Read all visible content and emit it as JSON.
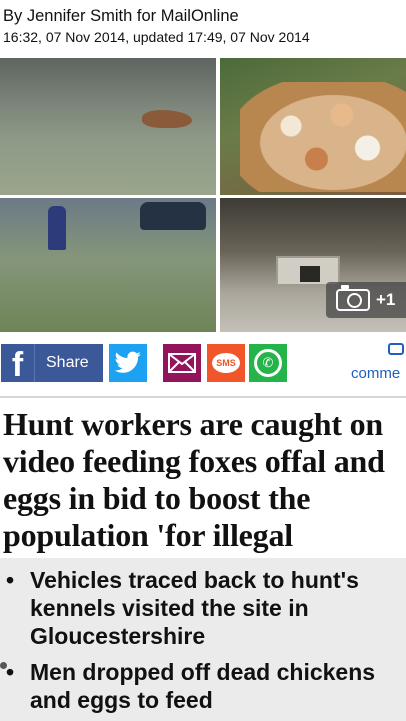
{
  "byline": {
    "author": "By Jennifer Smith for MailOnline",
    "dates": "16:32, 07 Nov 2014, updated 17:49, 07 Nov 2014"
  },
  "gallery": {
    "photo_count": "+1",
    "icons": [
      "camera-icon"
    ]
  },
  "share": {
    "facebook_label": "Share",
    "comments_label": "comme",
    "icons": [
      "facebook-icon",
      "twitter-icon",
      "email-icon",
      "sms-icon",
      "whatsapp-icon",
      "comment-icon"
    ],
    "sms_text": "SMS",
    "colors": {
      "facebook": "#3b5998",
      "twitter": "#1da1f2",
      "email": "#93145b",
      "sms": "#f0562a",
      "whatsapp": "#25b44a",
      "comments": "#1e60c0"
    }
  },
  "article": {
    "headline": "Hunt workers are caught on video feeding foxes offal and eggs in bid to boost the population 'for illegal hunting'",
    "bullets": [
      "Vehicles traced back to hunt's kennels visited the site in Gloucestershire",
      "Men dropped off dead chickens and eggs to feed"
    ]
  }
}
